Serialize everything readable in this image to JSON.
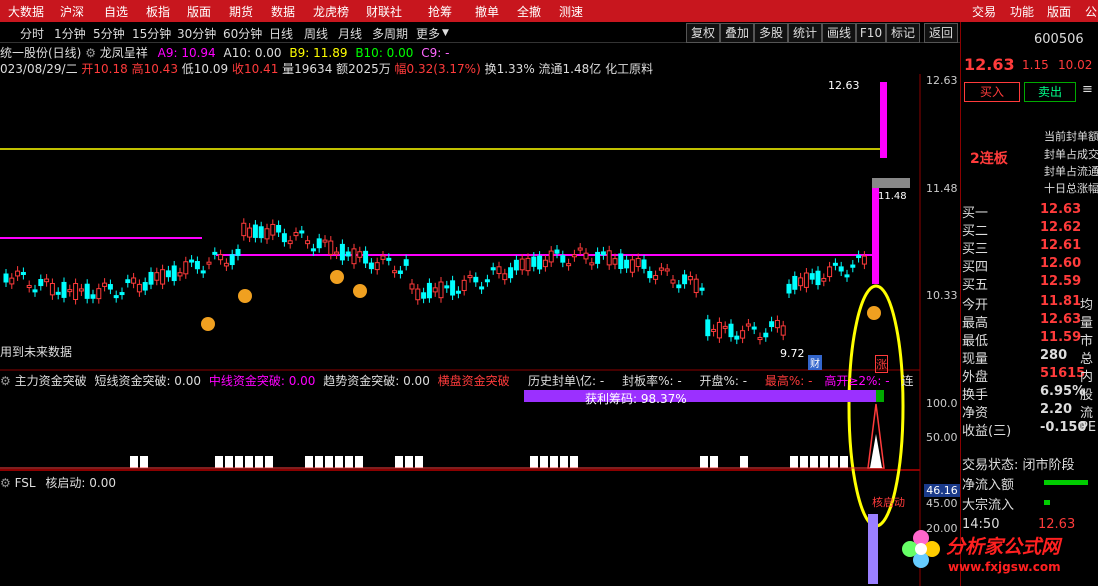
{
  "menu": [
    "大数据",
    "沪深",
    "自选",
    "板指",
    "版面",
    "期货",
    "数据",
    "龙虎榜",
    "财联社",
    "抢筹",
    "撤单",
    "全撤",
    "测速",
    "交易",
    "功能",
    "版面",
    "公"
  ],
  "periods": [
    "分时",
    "1分钟",
    "5分钟",
    "15分钟",
    "30分钟",
    "60分钟",
    "日线",
    "周线",
    "月线",
    "多周期",
    "更多"
  ],
  "toolbar": [
    "复权",
    "叠加",
    "多股",
    "统计",
    "画线",
    "F10",
    "标记",
    "返回"
  ],
  "stock": {
    "name": "统一股份(日线)",
    "indicator_name": "龙凤呈祥",
    "code": "600506",
    "short_name": "统一股份"
  },
  "ma": {
    "a9": "A9: 10.94",
    "a10": "A10: 0.00",
    "b9": "B9: 11.89",
    "b10": "B10: 0.00",
    "c9": "C9: -"
  },
  "bar_info": {
    "date": "023/08/29/二",
    "open": "开10.18",
    "high": "高10.43",
    "low": "低10.09",
    "close": "收10.41",
    "vol": "量19634",
    "amt": "额2025万",
    "chg": "幅0.32(3.17%)",
    "turn": "换1.33%",
    "float": "流通1.48亿",
    "sector": "化工原料"
  },
  "price_axis": [
    "12.63",
    "11.48",
    "10.33"
  ],
  "chart_labels": {
    "high_marker": "12.63",
    "low_marker": "9.72",
    "level_marker": "11.48",
    "future": "用到未来数据",
    "cai": "财",
    "zhang": "涨"
  },
  "mid_panel": {
    "title": "主力资金突破",
    "short": "短线资金突破: 0.00",
    "mid": "中线资金突破: 0.00",
    "trend": "趋势资金突破: 0.00",
    "flat": "横盘资金突破",
    "hist": "历史封单\\亿: -",
    "seal_rate": "封板率%: -",
    "open": "开盘%: -",
    "high": "最高%: -",
    "gap": "高开≥2%: -",
    "extra": "连",
    "profit_label": "获利筹码:  98.37%",
    "profit": 98.37,
    "axis": [
      "100.0",
      "50.00"
    ]
  },
  "low_panel": {
    "title": "FSL",
    "core": "核启动: 0.00",
    "value": "46.16",
    "axis": [
      "45.00",
      "20.00"
    ],
    "launch": "核启动"
  },
  "right": {
    "price": "12.63",
    "chg": "1.15",
    "pct": "10.02",
    "buy_btn": "买入",
    "sell_btn": "卖出",
    "menu_icon": "≡",
    "board": "2连板",
    "seal_items": [
      "当前封单额",
      "封单占成交",
      "封单占流通",
      "十日总涨幅"
    ],
    "bids": [
      {
        "label": "买一",
        "price": "12.63"
      },
      {
        "label": "买二",
        "price": "12.62"
      },
      {
        "label": "买三",
        "price": "12.61"
      },
      {
        "label": "买四",
        "price": "12.60"
      },
      {
        "label": "买五",
        "price": "12.59"
      }
    ],
    "stats": [
      {
        "label": "今开",
        "value": "11.81",
        "extra": "均"
      },
      {
        "label": "最高",
        "value": "12.63",
        "extra": "量"
      },
      {
        "label": "最低",
        "value": "11.59",
        "extra": "市"
      },
      {
        "label": "现量",
        "value": "280",
        "extra": "总"
      },
      {
        "label": "外盘",
        "value": "51615",
        "extra": "内"
      },
      {
        "label": "换手",
        "value": "6.95%",
        "extra": "股"
      },
      {
        "label": "净资",
        "value": "2.20",
        "extra": "流"
      },
      {
        "label": "收益(三)",
        "value": "-0.150",
        "extra": "PE"
      }
    ],
    "trade_status": "交易状态: 闭市阶段",
    "net_inflow": "净流入额",
    "block_inflow": "大宗流入",
    "time": "14:50",
    "time_price": "12.63"
  },
  "watermark": {
    "cn": "分析家公式网",
    "url": "www.fxjgsw.com"
  },
  "colors": {
    "up": "#ff3b3b",
    "down": "#00ffff",
    "magenta": "#ff00ff",
    "yellow": "#ffff00",
    "bg": "#000000",
    "red_bar": "#c8161e"
  }
}
